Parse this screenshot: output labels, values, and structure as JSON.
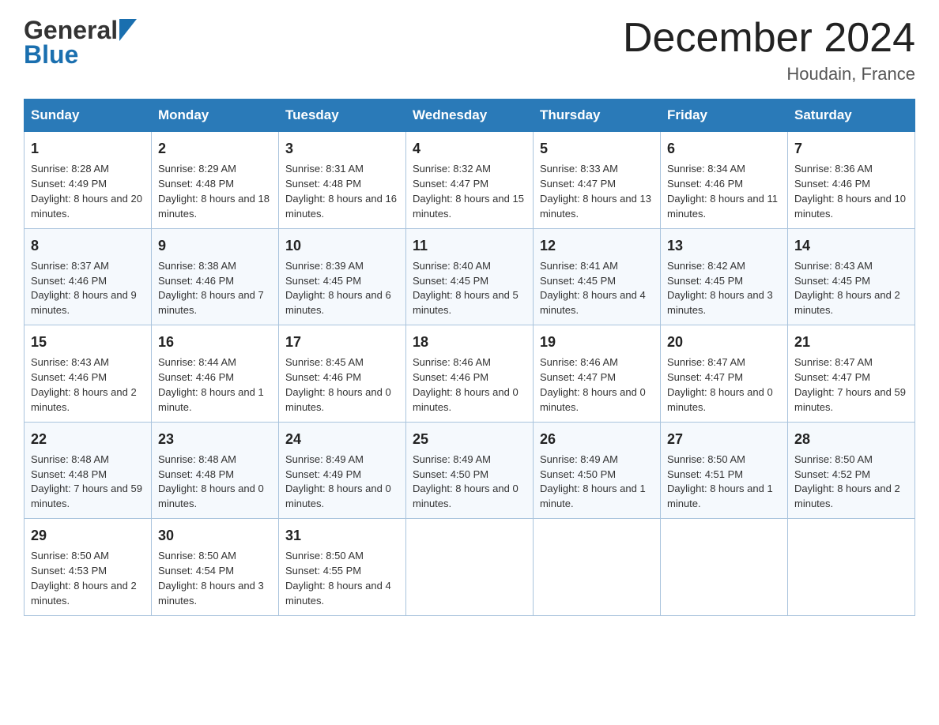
{
  "header": {
    "logo_line1": "General",
    "logo_line2": "Blue",
    "month_title": "December 2024",
    "location": "Houdain, France"
  },
  "days_of_week": [
    "Sunday",
    "Monday",
    "Tuesday",
    "Wednesday",
    "Thursday",
    "Friday",
    "Saturday"
  ],
  "weeks": [
    [
      {
        "day": "1",
        "sunrise": "8:28 AM",
        "sunset": "4:49 PM",
        "daylight": "8 hours and 20 minutes."
      },
      {
        "day": "2",
        "sunrise": "8:29 AM",
        "sunset": "4:48 PM",
        "daylight": "8 hours and 18 minutes."
      },
      {
        "day": "3",
        "sunrise": "8:31 AM",
        "sunset": "4:48 PM",
        "daylight": "8 hours and 16 minutes."
      },
      {
        "day": "4",
        "sunrise": "8:32 AM",
        "sunset": "4:47 PM",
        "daylight": "8 hours and 15 minutes."
      },
      {
        "day": "5",
        "sunrise": "8:33 AM",
        "sunset": "4:47 PM",
        "daylight": "8 hours and 13 minutes."
      },
      {
        "day": "6",
        "sunrise": "8:34 AM",
        "sunset": "4:46 PM",
        "daylight": "8 hours and 11 minutes."
      },
      {
        "day": "7",
        "sunrise": "8:36 AM",
        "sunset": "4:46 PM",
        "daylight": "8 hours and 10 minutes."
      }
    ],
    [
      {
        "day": "8",
        "sunrise": "8:37 AM",
        "sunset": "4:46 PM",
        "daylight": "8 hours and 9 minutes."
      },
      {
        "day": "9",
        "sunrise": "8:38 AM",
        "sunset": "4:46 PM",
        "daylight": "8 hours and 7 minutes."
      },
      {
        "day": "10",
        "sunrise": "8:39 AM",
        "sunset": "4:45 PM",
        "daylight": "8 hours and 6 minutes."
      },
      {
        "day": "11",
        "sunrise": "8:40 AM",
        "sunset": "4:45 PM",
        "daylight": "8 hours and 5 minutes."
      },
      {
        "day": "12",
        "sunrise": "8:41 AM",
        "sunset": "4:45 PM",
        "daylight": "8 hours and 4 minutes."
      },
      {
        "day": "13",
        "sunrise": "8:42 AM",
        "sunset": "4:45 PM",
        "daylight": "8 hours and 3 minutes."
      },
      {
        "day": "14",
        "sunrise": "8:43 AM",
        "sunset": "4:45 PM",
        "daylight": "8 hours and 2 minutes."
      }
    ],
    [
      {
        "day": "15",
        "sunrise": "8:43 AM",
        "sunset": "4:46 PM",
        "daylight": "8 hours and 2 minutes."
      },
      {
        "day": "16",
        "sunrise": "8:44 AM",
        "sunset": "4:46 PM",
        "daylight": "8 hours and 1 minute."
      },
      {
        "day": "17",
        "sunrise": "8:45 AM",
        "sunset": "4:46 PM",
        "daylight": "8 hours and 0 minutes."
      },
      {
        "day": "18",
        "sunrise": "8:46 AM",
        "sunset": "4:46 PM",
        "daylight": "8 hours and 0 minutes."
      },
      {
        "day": "19",
        "sunrise": "8:46 AM",
        "sunset": "4:47 PM",
        "daylight": "8 hours and 0 minutes."
      },
      {
        "day": "20",
        "sunrise": "8:47 AM",
        "sunset": "4:47 PM",
        "daylight": "8 hours and 0 minutes."
      },
      {
        "day": "21",
        "sunrise": "8:47 AM",
        "sunset": "4:47 PM",
        "daylight": "7 hours and 59 minutes."
      }
    ],
    [
      {
        "day": "22",
        "sunrise": "8:48 AM",
        "sunset": "4:48 PM",
        "daylight": "7 hours and 59 minutes."
      },
      {
        "day": "23",
        "sunrise": "8:48 AM",
        "sunset": "4:48 PM",
        "daylight": "8 hours and 0 minutes."
      },
      {
        "day": "24",
        "sunrise": "8:49 AM",
        "sunset": "4:49 PM",
        "daylight": "8 hours and 0 minutes."
      },
      {
        "day": "25",
        "sunrise": "8:49 AM",
        "sunset": "4:50 PM",
        "daylight": "8 hours and 0 minutes."
      },
      {
        "day": "26",
        "sunrise": "8:49 AM",
        "sunset": "4:50 PM",
        "daylight": "8 hours and 1 minute."
      },
      {
        "day": "27",
        "sunrise": "8:50 AM",
        "sunset": "4:51 PM",
        "daylight": "8 hours and 1 minute."
      },
      {
        "day": "28",
        "sunrise": "8:50 AM",
        "sunset": "4:52 PM",
        "daylight": "8 hours and 2 minutes."
      }
    ],
    [
      {
        "day": "29",
        "sunrise": "8:50 AM",
        "sunset": "4:53 PM",
        "daylight": "8 hours and 2 minutes."
      },
      {
        "day": "30",
        "sunrise": "8:50 AM",
        "sunset": "4:54 PM",
        "daylight": "8 hours and 3 minutes."
      },
      {
        "day": "31",
        "sunrise": "8:50 AM",
        "sunset": "4:55 PM",
        "daylight": "8 hours and 4 minutes."
      },
      null,
      null,
      null,
      null
    ]
  ],
  "labels": {
    "sunrise": "Sunrise:",
    "sunset": "Sunset:",
    "daylight": "Daylight:"
  }
}
